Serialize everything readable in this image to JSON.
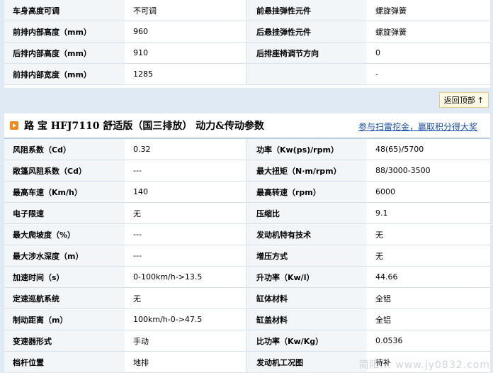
{
  "top_table": {
    "rows": [
      {
        "l1": "车身高度可调",
        "v1": "不可调",
        "l2": "前悬挂弹性元件",
        "v2": "螺旋弹簧"
      },
      {
        "l1": "前排内部高度（mm）",
        "v1": "960",
        "l2": "后悬挂弹性元件",
        "v2": "螺旋弹簧"
      },
      {
        "l1": "后排内部高度（mm）",
        "v1": "910",
        "l2": "后排座椅调节方向",
        "v2": "0"
      },
      {
        "l1": "前排内部宽度（mm）",
        "v1": "1285",
        "l2": "",
        "v2": "-"
      }
    ]
  },
  "back_to_top": {
    "label": "返回顶部",
    "arrow": "↑"
  },
  "section": {
    "title": "路 宝 HFJ7110 舒适版（国三排放） 动力&传动参数",
    "link": "参与扫雷挖金，赢取积分得大奖"
  },
  "params_table": {
    "rows": [
      {
        "l1": "风阻系数（Cd）",
        "v1": "0.32",
        "l2": "功率（Kw(ps)/rpm）",
        "v2": "48(65)/5700"
      },
      {
        "l1": "敞篷风阻系数（Cd）",
        "v1": "---",
        "l2": "最大扭矩（N·m/rpm）",
        "v2": "88/3000-3500"
      },
      {
        "l1": "最高车速（Km/h）",
        "v1": "140",
        "l2": "最高转速（rpm）",
        "v2": "6000"
      },
      {
        "l1": "电子限速",
        "v1": "无",
        "l2": "压缩比",
        "v2": "9.1"
      },
      {
        "l1": "最大爬坡度（%）",
        "v1": "---",
        "l2": "发动机特有技术",
        "v2": "无"
      },
      {
        "l1": "最大涉水深度（m）",
        "v1": "---",
        "l2": "增压方式",
        "v2": "无"
      },
      {
        "l1": "加速时间（s）",
        "v1": "0-100km/h->13.5",
        "l2": "升功率（Kw/l）",
        "v2": "44.66"
      },
      {
        "l1": "定速巡航系统",
        "v1": "无",
        "l2": "缸体材料",
        "v2": "全铝"
      },
      {
        "l1": "制动距离（m）",
        "v1": "100km/h-0->47.5",
        "l2": "缸盖材料",
        "v2": "全铝"
      },
      {
        "l1": "变速器形式",
        "v1": "手动",
        "l2": "比功率（Kw/Kg）",
        "v2": "0.0536"
      },
      {
        "l1": "档杆位置",
        "v1": "地排",
        "l2": "发动机工况图",
        "v2": "待补"
      }
    ]
  },
  "watermark": "简阳... www.jy0832.com"
}
